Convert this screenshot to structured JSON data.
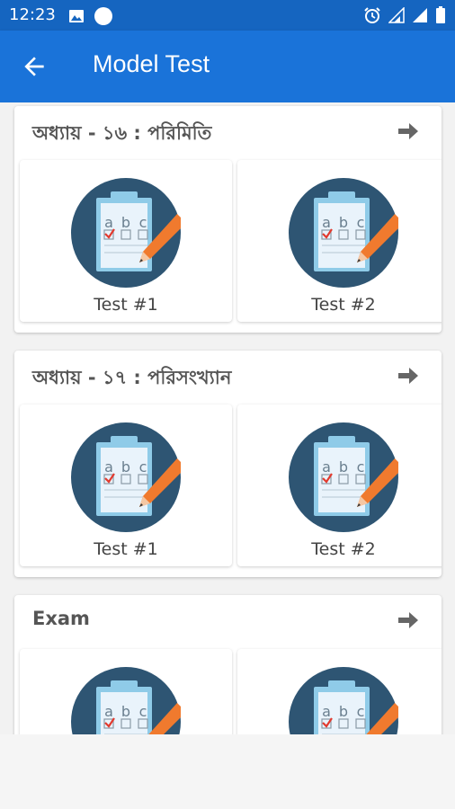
{
  "status_bar": {
    "time": "12:23",
    "left_icons": [
      "image-icon",
      "circle-icon"
    ],
    "right_icons": [
      "alarm-icon",
      "signal-icon",
      "signal-icon",
      "battery-icon"
    ]
  },
  "app_bar": {
    "title": "Model Test",
    "back_icon": "arrow-back-icon"
  },
  "sections": [
    {
      "title": "অধ্যায় - ১৬ : পরিমিতি",
      "tests": [
        {
          "label": "Test #1"
        },
        {
          "label": "Test #2"
        }
      ]
    },
    {
      "title": "অধ্যায় - ১৭ : পরিসংখ্যান",
      "tests": [
        {
          "label": "Test #1"
        },
        {
          "label": "Test #2"
        }
      ]
    },
    {
      "title": "Exam",
      "tests": [
        {
          "label": ""
        },
        {
          "label": ""
        }
      ]
    }
  ],
  "icon_letters": [
    "a",
    "b",
    "c"
  ],
  "colors": {
    "status_bar": "#1565c0",
    "app_bar": "#1a73d9",
    "icon_circle": "#2e5573",
    "clipboard": "#e9f3fb",
    "clip": "#8fcbe8",
    "pencil": "#f07a2e",
    "check": "#e23a2e"
  }
}
